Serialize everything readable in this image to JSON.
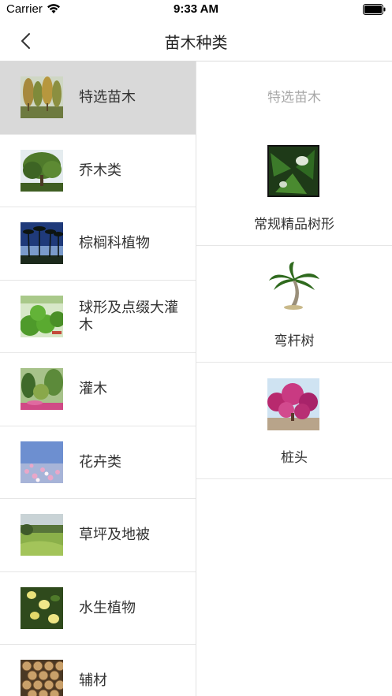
{
  "status_bar": {
    "carrier": "Carrier",
    "time": "9:33 AM"
  },
  "nav": {
    "title": "苗木种类",
    "back_icon": "chevron-left-icon"
  },
  "categories": [
    {
      "label": "特选苗木",
      "selected": true,
      "image": "tall-trees-photo"
    },
    {
      "label": "乔木类",
      "selected": false,
      "image": "broadleaf-tree-photo"
    },
    {
      "label": "棕榈科植物",
      "selected": false,
      "image": "palm-trees-photo"
    },
    {
      "label": "球形及点缀大灌木",
      "selected": false,
      "image": "topiary-balls-photo"
    },
    {
      "label": "灌木",
      "selected": false,
      "image": "garden-shrubs-photo"
    },
    {
      "label": "花卉类",
      "selected": false,
      "image": "cosmos-flowers-photo"
    },
    {
      "label": "草坪及地被",
      "selected": false,
      "image": "lawn-photo"
    },
    {
      "label": "水生植物",
      "selected": false,
      "image": "water-lily-photo"
    },
    {
      "label": "辅材",
      "selected": false,
      "image": "wood-logs-photo"
    }
  ],
  "right_panel": {
    "header": "特选苗木",
    "items": [
      {
        "label": "常规精品树形",
        "image": "pine-foliage-photo"
      },
      {
        "label": "弯杆树",
        "image": "curved-palm-photo"
      },
      {
        "label": "桩头",
        "image": "bougainvillea-stump-photo"
      }
    ]
  },
  "colors": {
    "selected_row": "#d9d9d9",
    "divider": "#e6e6e6",
    "muted_text": "#a8a8a8"
  }
}
